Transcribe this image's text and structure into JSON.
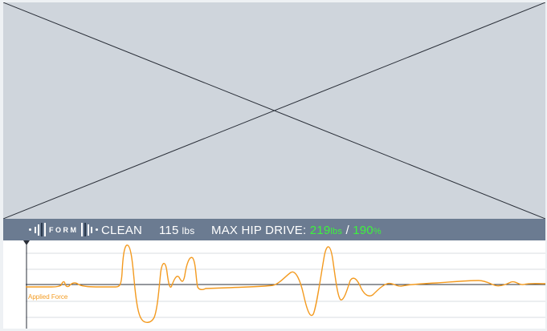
{
  "logo": {
    "word": "FORM"
  },
  "status": {
    "exercise": "CLEAN",
    "weight_value": "115",
    "weight_unit": "lbs",
    "hip_label": "MAX HIP DRIVE:",
    "hip_value": "219",
    "hip_unit": "lbs",
    "separator": "/",
    "hip_percent_value": "190",
    "hip_percent_unit": "%"
  },
  "colors": {
    "video_bg": "#cfd5dc",
    "status_bg": "#6b7b91",
    "accent_green": "#3ef23e",
    "force_line": "#f39a1f"
  },
  "chart_data": {
    "type": "line",
    "series": [
      {
        "name": "Applied Force",
        "values": []
      }
    ]
  },
  "chart": {
    "series_label": "Applied Force"
  }
}
